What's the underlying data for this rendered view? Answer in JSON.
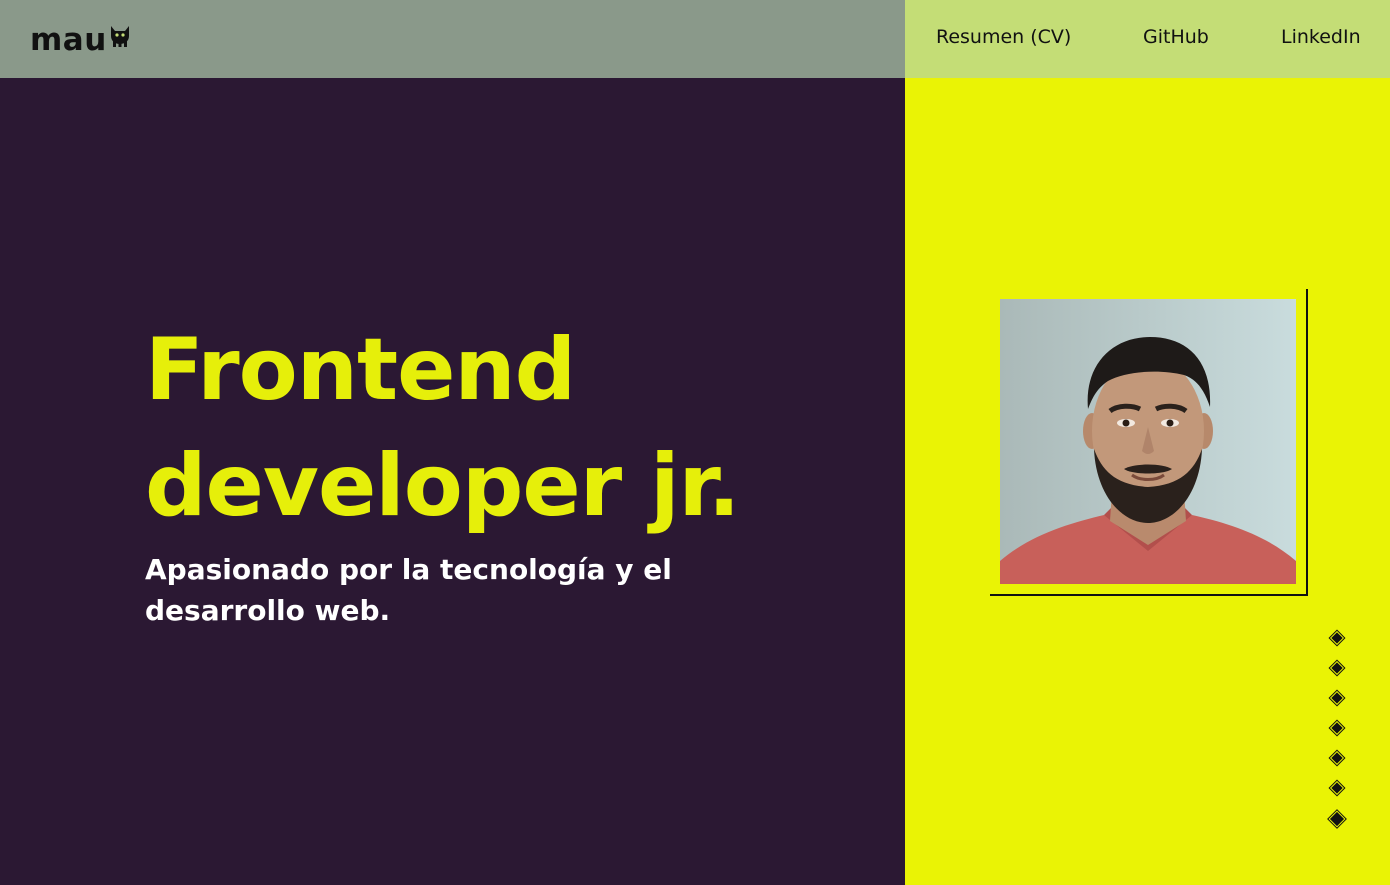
{
  "brand": {
    "logo_text": "mau",
    "logo_icon": "cat-icon"
  },
  "nav": {
    "items": [
      {
        "label": "Resumen (CV)"
      },
      {
        "label": "GitHub"
      },
      {
        "label": "LinkedIn"
      }
    ]
  },
  "hero": {
    "title": "Frontend developer jr.",
    "subtitle": "Apasionado por la tecnología y el desarrollo web."
  },
  "profile_photo": {
    "icon": "profile-photo"
  },
  "pagination": {
    "count": 7,
    "active_index": 6
  },
  "colors": {
    "left_bg": "#2b1833",
    "right_bg": "#eaf305",
    "topbar_left": "#8a998a",
    "topbar_right": "#c4dd76",
    "title": "#e6ef0a",
    "subtitle": "#ffffff"
  }
}
